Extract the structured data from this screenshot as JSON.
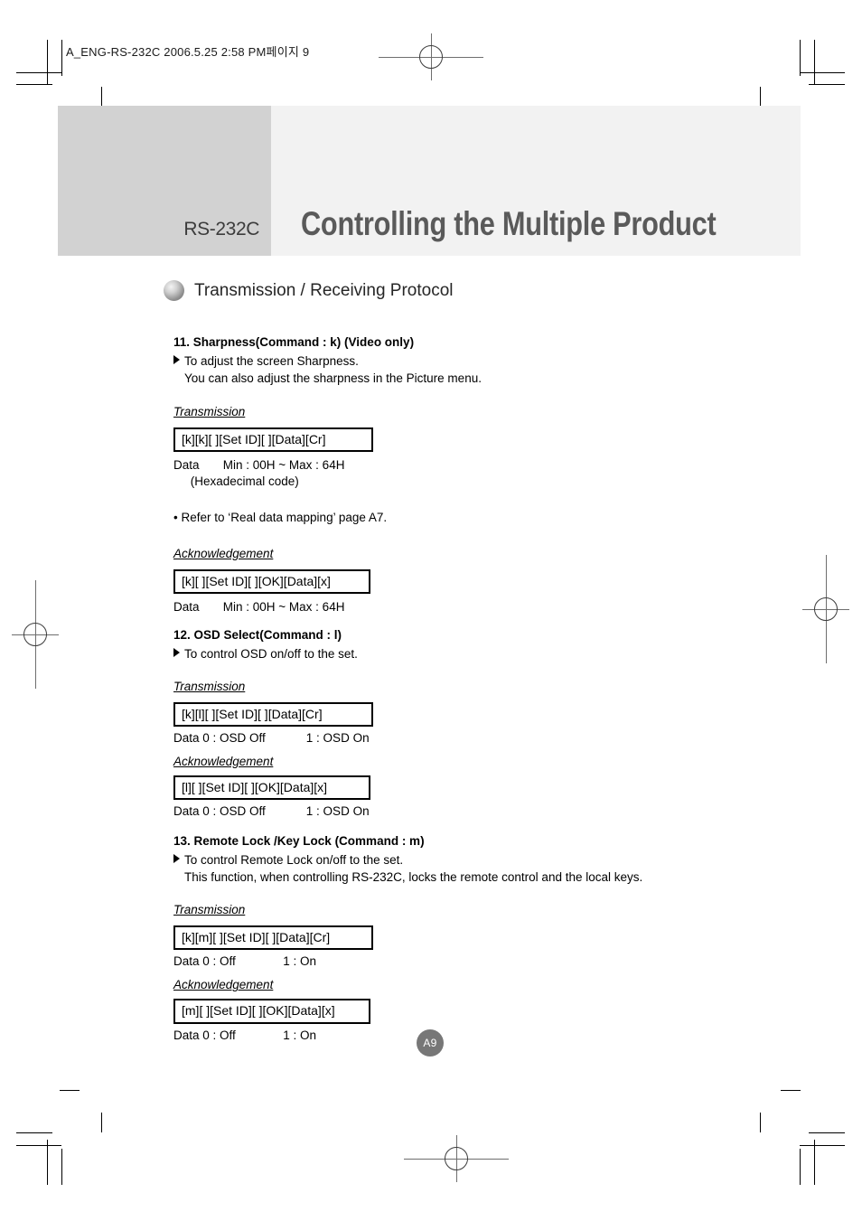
{
  "page": {
    "slug": "A_ENG-RS-232C  2006.5.25  2:58 PM페이지 9",
    "badge": "A9"
  },
  "header": {
    "tag": "RS-232C",
    "title": "Controlling the Multiple Product"
  },
  "protocol": {
    "bullet_icon": "sphere-bullet-icon",
    "heading": "Transmission / Receiving Protocol"
  },
  "labels": {
    "transmission": "Transmission",
    "acknowledgement": "Acknowledgement"
  },
  "sections": [
    {
      "title": "11. Sharpness(Command : k) (Video only)",
      "desc1": "To adjust the screen Sharpness.",
      "desc2": "You can also adjust the sharpness in the Picture menu.",
      "transmission_box": "[k][k][ ][Set ID][ ][Data][Cr]",
      "transmission_data1": "Data       Min : 00H ~ Max : 64H",
      "transmission_data2": "     (Hexadecimal code)",
      "note": "• Refer to ‘Real data mapping’ page A7.",
      "ack_box": "[k][ ][Set ID][ ][OK][Data][x]",
      "ack_data1": "Data       Min : 00H ~ Max : 64H"
    },
    {
      "title": "12. OSD Select(Command : l)",
      "desc1": "To control OSD on/off to the set.",
      "transmission_box": "[k][l][ ][Set ID][ ][Data][Cr]",
      "transmission_data1": "Data 0 : OSD Off            1 : OSD On",
      "ack_box": "[l][ ][Set ID][ ][OK][Data][x]",
      "ack_data1": "Data 0 : OSD Off            1 : OSD On"
    },
    {
      "title": "13. Remote Lock /Key Lock (Command : m)",
      "desc1": "To control Remote Lock on/off to the set.",
      "desc2": "This function, when controlling RS-232C, locks the remote control and the local keys.",
      "transmission_box": "[k][m][ ][Set ID][ ][Data][Cr]",
      "transmission_data1": "Data 0 : Off              1 : On",
      "ack_box": "[m][ ][Set ID][ ][OK][Data][x]",
      "ack_data1": "Data 0 : Off              1 : On"
    }
  ]
}
